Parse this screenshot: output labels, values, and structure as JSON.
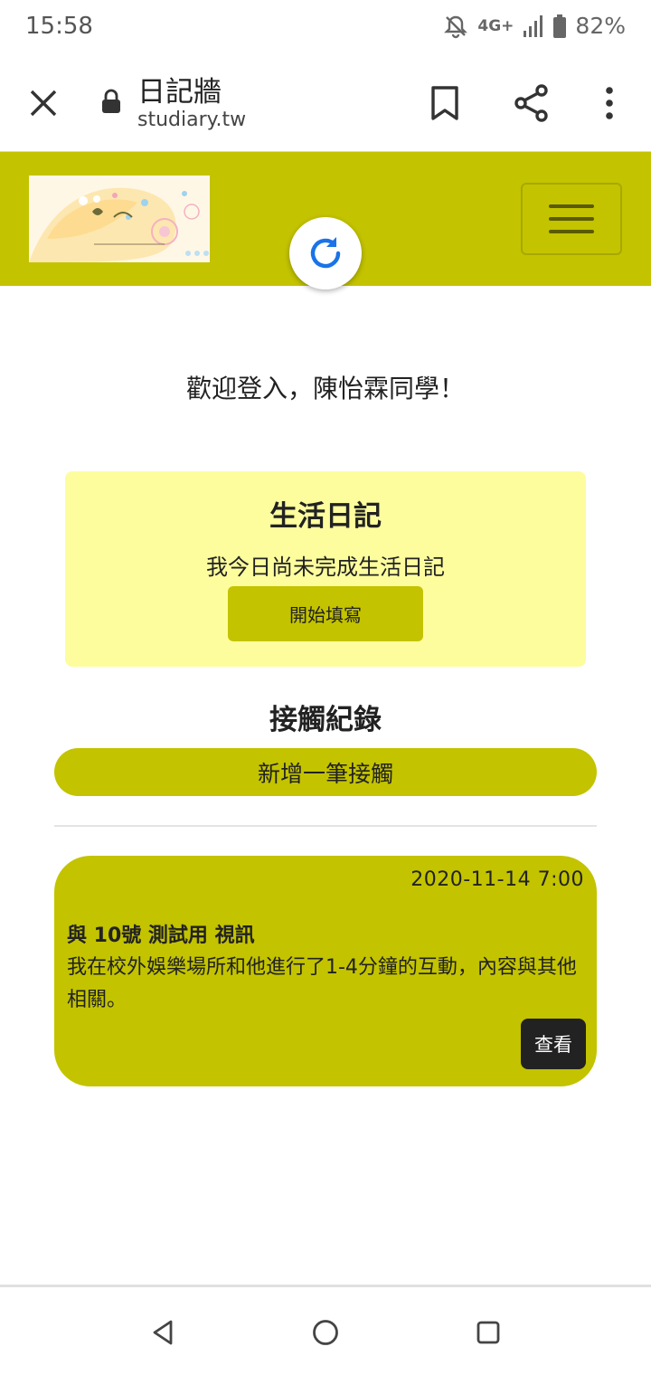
{
  "status_bar": {
    "time": "15:58",
    "network": "4G+",
    "battery": "82%"
  },
  "browser": {
    "page_title": "日記牆",
    "url": "studiary.tw"
  },
  "welcome": {
    "text": "歡迎登入，陳怡霖同學！"
  },
  "diary": {
    "title": "生活日記",
    "status": "我今日尚未完成生活日記",
    "start_label": "開始填寫"
  },
  "contacts": {
    "heading": "接觸紀錄",
    "add_label": "新增一筆接觸",
    "records": [
      {
        "time": "2020-11-14 7:00",
        "title": "與 10號 測試用 視訊",
        "description": "我在校外娛樂場所和他進行了1-4分鐘的互動，內容與其他相關。",
        "view_label": "查看"
      }
    ]
  },
  "colors": {
    "accent": "#c3c300",
    "card": "#fdfd9e"
  }
}
